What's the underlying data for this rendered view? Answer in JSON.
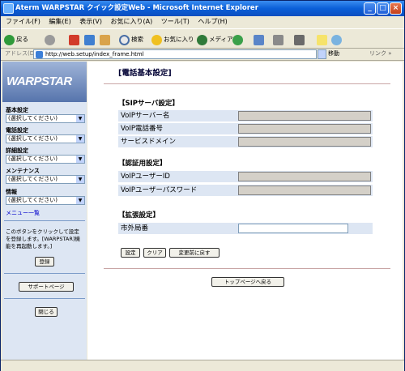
{
  "window": {
    "title": "Aterm WARPSTAR クイック設定Web - Microsoft Internet Explorer"
  },
  "menubar": [
    "ファイル(F)",
    "編集(E)",
    "表示(V)",
    "お気に入り(A)",
    "ツール(T)",
    "ヘルプ(H)"
  ],
  "toolbar": {
    "back": "戻る",
    "search": "検索",
    "favorites": "お気に入り",
    "media": "メディア"
  },
  "address": {
    "label": "アドレス(D)",
    "url": "http://web.setup/index_frame.html",
    "go": "移動",
    "links": "リンク"
  },
  "sidebar": {
    "logo": "WARPSTAR",
    "groups": [
      {
        "title": "基本設定",
        "value": "(選択してください)"
      },
      {
        "title": "電話設定",
        "value": "(選択してください)"
      },
      {
        "title": "詳細設定",
        "value": "(選択してください)"
      },
      {
        "title": "メンテナンス",
        "value": "(選択してください)"
      },
      {
        "title": "情報",
        "value": "(選択してください)"
      }
    ],
    "menu_link": "メニュー一覧",
    "note": "このボタンをクリックして設定を登録します。[WARPSTAR]機能を再起動します。]",
    "register_button": "登録",
    "support_button": "サポートページ",
    "close_button": "閉じる"
  },
  "main": {
    "title": "[電話基本設定]",
    "sections": [
      {
        "heading": "【SIPサーバ設定】",
        "fields": [
          "VoIPサーバー名",
          "VoIP電話番号",
          "サービスドメイン"
        ]
      },
      {
        "heading": "【認証用設定】",
        "fields": [
          "VoIPユーザーID",
          "VoIPユーザーパスワード"
        ]
      },
      {
        "heading": "【拡張設定】",
        "fields": [
          "市外局番"
        ]
      }
    ],
    "buttons": {
      "set": "設定",
      "clear": "クリア",
      "revert": "変更前に戻す"
    },
    "top_button": "トップページへ戻る"
  }
}
